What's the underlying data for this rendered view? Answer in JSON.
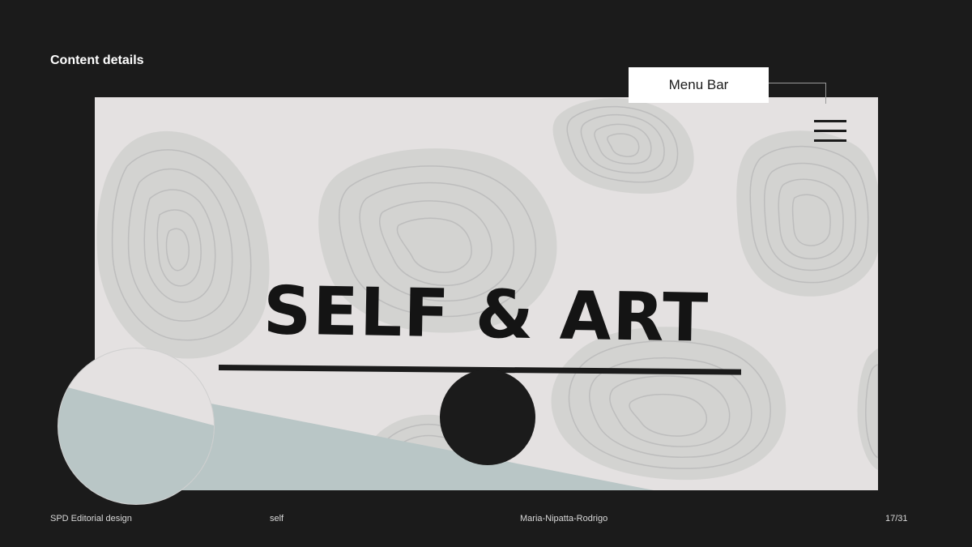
{
  "section": {
    "title": "Content details"
  },
  "hero": {
    "title": "SELF & ART"
  },
  "callout": {
    "label": "Menu Bar"
  },
  "icons": {
    "menu": "hamburger-menu-icon",
    "scroll": "chevron-down-icon"
  },
  "colors": {
    "background": "#1b1b1b",
    "frame": "#e4e1e1",
    "stone": "#d3d3d1",
    "stone_line": "#bdbdbd",
    "accent": "#b9c6c6",
    "ink": "#141414"
  },
  "footer": {
    "project": "SPD Editorial design",
    "topic": "self",
    "author": "Maria-Nipatta-Rodrigo",
    "page": "17/31"
  }
}
